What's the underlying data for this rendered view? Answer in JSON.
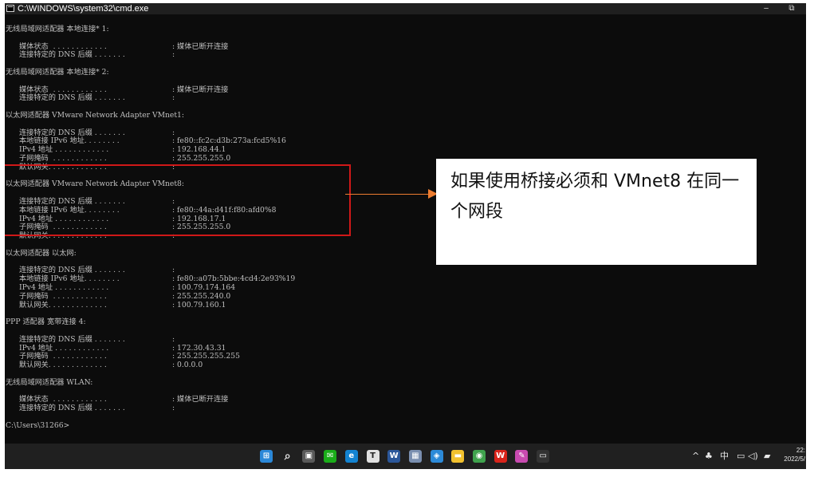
{
  "window": {
    "title": "C:\\WINDOWS\\system32\\cmd.exe",
    "minimize_label": "–",
    "maximize_label": "⧉"
  },
  "console": {
    "lines": [
      {
        "label": "无线局域网适配器 本地连接* 1:"
      },
      {
        "label": ""
      },
      {
        "label": "媒体状态  . . . . . . . . . . . .",
        "value": ": 媒体已断开连接"
      },
      {
        "label": "连接特定的 DNS 后缀 . . . . . . .",
        "value": ":"
      },
      {
        "label": ""
      },
      {
        "label": "无线局域网适配器 本地连接* 2:"
      },
      {
        "label": ""
      },
      {
        "label": "媒体状态  . . . . . . . . . . . .",
        "value": ": 媒体已断开连接"
      },
      {
        "label": "连接特定的 DNS 后缀 . . . . . . .",
        "value": ":"
      },
      {
        "label": ""
      },
      {
        "label": "以太网适配器 VMware Network Adapter VMnet1:"
      },
      {
        "label": ""
      },
      {
        "label": "连接特定的 DNS 后缀 . . . . . . .",
        "value": ":"
      },
      {
        "label": "本地链接 IPv6 地址. . . . . . . .",
        "value": ": fe80::fc2c:d3b:273a:fcd5%16"
      },
      {
        "label": "IPv4 地址 . . . . . . . . . . . .",
        "value": ": 192.168.44.1"
      },
      {
        "label": "子网掩码  . . . . . . . . . . . .",
        "value": ": 255.255.255.0"
      },
      {
        "label": "默认网关. . . . . . . . . . . . .",
        "value": ":"
      },
      {
        "label": ""
      },
      {
        "label": "以太网适配器 VMware Network Adapter VMnet8:"
      },
      {
        "label": ""
      },
      {
        "label": "连接特定的 DNS 后缀 . . . . . . .",
        "value": ":"
      },
      {
        "label": "本地链接 IPv6 地址. . . . . . . .",
        "value": ": fe80::44a:d41f:f80:afd0%8"
      },
      {
        "label": "IPv4 地址 . . . . . . . . . . . .",
        "value": ": 192.168.17.1"
      },
      {
        "label": "子网掩码  . . . . . . . . . . . .",
        "value": ": 255.255.255.0"
      },
      {
        "label": "默认网关. . . . . . . . . . . . .",
        "value": ":"
      },
      {
        "label": ""
      },
      {
        "label": "以太网适配器 以太网:"
      },
      {
        "label": ""
      },
      {
        "label": "连接特定的 DNS 后缀 . . . . . . .",
        "value": ":"
      },
      {
        "label": "本地链接 IPv6 地址. . . . . . . .",
        "value": ": fe80::a07b:5bbe:4cd4:2e93%19"
      },
      {
        "label": "IPv4 地址 . . . . . . . . . . . .",
        "value": ": 100.79.174.164"
      },
      {
        "label": "子网掩码  . . . . . . . . . . . .",
        "value": ": 255.255.240.0"
      },
      {
        "label": "默认网关. . . . . . . . . . . . .",
        "value": ": 100.79.160.1"
      },
      {
        "label": ""
      },
      {
        "label": "PPP 适配器 宽带连接 4:"
      },
      {
        "label": ""
      },
      {
        "label": "连接特定的 DNS 后缀 . . . . . . .",
        "value": ":"
      },
      {
        "label": "IPv4 地址 . . . . . . . . . . . .",
        "value": ": 172.30.43.31"
      },
      {
        "label": "子网掩码  . . . . . . . . . . . .",
        "value": ": 255.255.255.255"
      },
      {
        "label": "默认网关. . . . . . . . . . . . .",
        "value": ": 0.0.0.0"
      },
      {
        "label": ""
      },
      {
        "label": "无线局域网适配器 WLAN:"
      },
      {
        "label": ""
      },
      {
        "label": "媒体状态  . . . . . . . . . . . .",
        "value": ": 媒体已断开连接"
      },
      {
        "label": "连接特定的 DNS 后缀 . . . . . . .",
        "value": ":"
      },
      {
        "label": ""
      },
      {
        "label": "C:\\Users\\31266>"
      }
    ]
  },
  "annotation": {
    "callout_text": "如果使用桥接必须和 VMnet8 在同一个网段",
    "box_color": "#d01818",
    "arrow_color": "#ed7d31"
  },
  "taskbar": {
    "icons": [
      {
        "name": "start-icon",
        "glyph": "⊞",
        "color": "#2b88d8"
      },
      {
        "name": "search-icon",
        "glyph": "⌕",
        "color": "#202020"
      },
      {
        "name": "task-view-icon",
        "glyph": "▣",
        "color": "#5a5a5a"
      },
      {
        "name": "wechat-icon",
        "glyph": "✉",
        "color": "#1aad19"
      },
      {
        "name": "edge-icon",
        "glyph": "e",
        "color": "#1383d1"
      },
      {
        "name": "typora-icon",
        "glyph": "T",
        "color": "#e0e0e0"
      },
      {
        "name": "word-icon",
        "glyph": "W",
        "color": "#2b579a"
      },
      {
        "name": "image-app-icon",
        "glyph": "▦",
        "color": "#7a8fb0"
      },
      {
        "name": "app-icon",
        "glyph": "◈",
        "color": "#2c8ad8"
      },
      {
        "name": "file-explorer-icon",
        "glyph": "▬",
        "color": "#f2c12e"
      },
      {
        "name": "screen-app-icon",
        "glyph": "◉",
        "color": "#3fa34d"
      },
      {
        "name": "wps-icon",
        "glyph": "W",
        "color": "#d9241b"
      },
      {
        "name": "paint-app-icon",
        "glyph": "✎",
        "color": "#c84ab0"
      },
      {
        "name": "cmd-icon",
        "glyph": "▭",
        "color": "#333333"
      }
    ],
    "tray": {
      "chevron": "^",
      "ime": "中",
      "clock_time": "22:",
      "clock_date": "2022/5/"
    }
  }
}
